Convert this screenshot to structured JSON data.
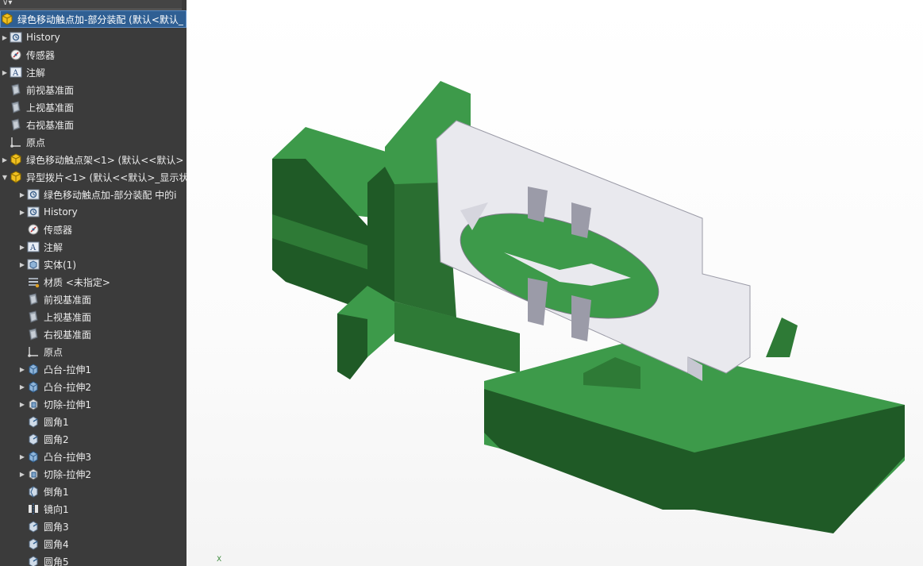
{
  "tree": {
    "root_label": "绿色移动触点加-部分装配 (默认<默认_",
    "items": [
      {
        "label": "History",
        "icon": "history-icon",
        "indent": 0,
        "expand": true
      },
      {
        "label": "传感器",
        "icon": "sensor-icon",
        "indent": 0,
        "expand": false
      },
      {
        "label": "注解",
        "icon": "annotation-icon",
        "indent": 0,
        "expand": true
      },
      {
        "label": "前视基准面",
        "icon": "plane-icon",
        "indent": 0,
        "expand": false
      },
      {
        "label": "上视基准面",
        "icon": "plane-icon",
        "indent": 0,
        "expand": false
      },
      {
        "label": "右视基准面",
        "icon": "plane-icon",
        "indent": 0,
        "expand": false
      },
      {
        "label": "原点",
        "icon": "origin-icon",
        "indent": 0,
        "expand": false
      },
      {
        "label": "绿色移动触点架<1> (默认<<默认>",
        "icon": "part-icon",
        "indent": 0,
        "expand": true
      },
      {
        "label": "异型拨片<1> (默认<<默认>_显示状",
        "icon": "part-icon",
        "indent": 0,
        "expand": "open"
      },
      {
        "label": "绿色移动触点加-部分装配 中的i",
        "icon": "history-icon",
        "indent": 1,
        "expand": true
      },
      {
        "label": "History",
        "icon": "history-icon",
        "indent": 1,
        "expand": true
      },
      {
        "label": "传感器",
        "icon": "sensor-icon",
        "indent": 1,
        "expand": false
      },
      {
        "label": "注解",
        "icon": "annotation-icon",
        "indent": 1,
        "expand": true
      },
      {
        "label": "实体(1)",
        "icon": "solid-body-icon",
        "indent": 1,
        "expand": true
      },
      {
        "label": "材质 <未指定>",
        "icon": "material-icon",
        "indent": 1,
        "expand": false
      },
      {
        "label": "前视基准面",
        "icon": "plane-icon",
        "indent": 1,
        "expand": false
      },
      {
        "label": "上视基准面",
        "icon": "plane-icon",
        "indent": 1,
        "expand": false
      },
      {
        "label": "右视基准面",
        "icon": "plane-icon",
        "indent": 1,
        "expand": false
      },
      {
        "label": "原点",
        "icon": "origin-icon",
        "indent": 1,
        "expand": false
      },
      {
        "label": "凸台-拉伸1",
        "icon": "extrude-icon",
        "indent": 1,
        "expand": true
      },
      {
        "label": "凸台-拉伸2",
        "icon": "extrude-icon",
        "indent": 1,
        "expand": true
      },
      {
        "label": "切除-拉伸1",
        "icon": "cut-extrude-icon",
        "indent": 1,
        "expand": true
      },
      {
        "label": "圆角1",
        "icon": "fillet-icon",
        "indent": 1,
        "expand": false
      },
      {
        "label": "圆角2",
        "icon": "fillet-icon",
        "indent": 1,
        "expand": false
      },
      {
        "label": "凸台-拉伸3",
        "icon": "extrude-icon",
        "indent": 1,
        "expand": true
      },
      {
        "label": "切除-拉伸2",
        "icon": "cut-extrude-icon",
        "indent": 1,
        "expand": true
      },
      {
        "label": "倒角1",
        "icon": "chamfer-icon",
        "indent": 1,
        "expand": false
      },
      {
        "label": "镜向1",
        "icon": "mirror-icon",
        "indent": 1,
        "expand": false
      },
      {
        "label": "圆角3",
        "icon": "fillet-icon",
        "indent": 1,
        "expand": false
      },
      {
        "label": "圆角4",
        "icon": "fillet-icon",
        "indent": 1,
        "expand": false
      },
      {
        "label": "圆角5",
        "icon": "fillet-icon",
        "indent": 1,
        "expand": false
      }
    ]
  },
  "viewport": {
    "triad_label": "X"
  },
  "colors": {
    "panel_bg": "#3b3b3b",
    "selection": "#2f5f93",
    "green_top": "#3d9a4a",
    "green_side": "#1f5a26",
    "plate": "#e9e9ee"
  }
}
